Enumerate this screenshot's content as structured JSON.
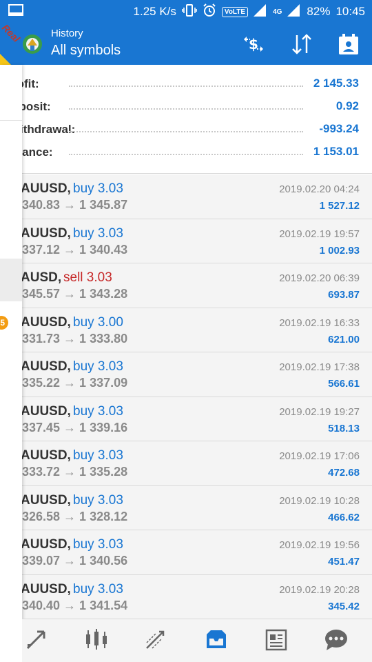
{
  "status_bar": {
    "speed": "1.25 K/s",
    "volte": "VoLTE",
    "network": "4G",
    "battery": "82%",
    "time": "10:45"
  },
  "app_bar": {
    "title": "History",
    "subtitle": "All symbols",
    "account_badge": "Real",
    "actions": [
      "currency-exchange-icon",
      "sort-icon",
      "calendar-icon"
    ]
  },
  "summary": {
    "profit_label": "rofit:",
    "profit_value": "2 145.33",
    "deposit_label": "eposit:",
    "deposit_value": "0.92",
    "withdrawal_label": "Vithdrawal:",
    "withdrawal_value": "-993.24",
    "balance_label": "alance:",
    "balance_value": "1 153.01"
  },
  "deals": [
    {
      "symbol": "AUUSD,",
      "direction": "buy 3.03",
      "prices": "340.83 → 1 345.87",
      "time": "2019.02.20 04:24",
      "profit": "1 527.12"
    },
    {
      "symbol": "AUUSD,",
      "direction": "buy 3.03",
      "prices": "337.12 → 1 340.43",
      "time": "2019.02.19 19:57",
      "profit": "1 002.93"
    },
    {
      "symbol": "AUSD,",
      "direction": "sell 3.03",
      "prices": "345.57 → 1 343.28",
      "time": "2019.02.20 06:39",
      "profit": "693.87"
    },
    {
      "symbol": "AUUSD,",
      "direction": "buy 3.00",
      "prices": "331.73 → 1 333.80",
      "time": "2019.02.19 16:33",
      "profit": "621.00"
    },
    {
      "symbol": "AUUSD,",
      "direction": "buy 3.03",
      "prices": "335.22 → 1 337.09",
      "time": "2019.02.19 17:38",
      "profit": "566.61"
    },
    {
      "symbol": "AUUSD,",
      "direction": "buy 3.03",
      "prices": "337.45 → 1 339.16",
      "time": "2019.02.19 19:27",
      "profit": "518.13"
    },
    {
      "symbol": "AUUSD,",
      "direction": "buy 3.03",
      "prices": "333.72 → 1 335.28",
      "time": "2019.02.19 17:06",
      "profit": "472.68"
    },
    {
      "symbol": "AUUSD,",
      "direction": "buy 3.03",
      "prices": "326.58 → 1 328.12",
      "time": "2019.02.19 10:28",
      "profit": "466.62"
    },
    {
      "symbol": "AUUSD,",
      "direction": "buy 3.03",
      "prices": "339.07 → 1 340.56",
      "time": "2019.02.19 19:56",
      "profit": "451.47"
    },
    {
      "symbol": "AUUSD,",
      "direction": "buy 3.03",
      "prices": "340.40 → 1 341.54",
      "time": "2019.02.19 20:28",
      "profit": "345.42"
    }
  ],
  "drawer": {
    "badge": "5"
  },
  "bottom_nav": [
    "quotes-icon",
    "chart-icon",
    "trade-icon",
    "history-icon",
    "news-icon",
    "chat-icon"
  ],
  "colors": {
    "primary": "#1976d2",
    "buy": "#1976d2",
    "sell": "#c62828",
    "badge": "#f5c518"
  }
}
